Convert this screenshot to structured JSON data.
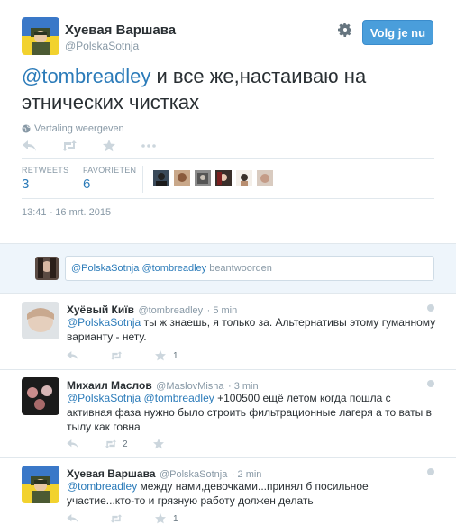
{
  "header": {
    "name": "Хуевая Варшава",
    "handle": "@PolskaSotnja",
    "follow_label": "Volg je nu"
  },
  "tweet": {
    "mention": "@tombreadley",
    "text": " и все же,настаиваю на этнических чистках",
    "translate_label": "Vertaling weergeven",
    "retweets_label": "RETWEETS",
    "retweets_count": "3",
    "favorites_label": "FAVORIETEN",
    "favorites_count": "6",
    "timestamp": "13:41 - 16 mrt. 2015"
  },
  "reply_box": {
    "mention_1": "@PolskaSotnja",
    "mention_2": "@tombreadley",
    "suffix": " beantwoorden"
  },
  "replies": [
    {
      "name": "Хуёвый Київ",
      "handle": "@tombreadley",
      "time": "· 5 min",
      "mention": "@PolskaSotnja",
      "text": " ты ж знаешь, я только за. Альтернативы этому гуманному варианту - нету.",
      "retweets": "",
      "favorites": "1"
    },
    {
      "name": "Михаил Маслов",
      "handle": "@MaslovMisha",
      "time": "· 3 min",
      "mention": "@PolskaSotnja @tombreadley",
      "text": " +100500 ещё летом когда пошла с активная фаза нужно было строить фильтрационные лагеря а то ваты в тылу как говна",
      "retweets": "2",
      "favorites": ""
    },
    {
      "name": "Хуевая Варшава",
      "handle": "@PolskaSotnja",
      "time": "· 2 min",
      "mention": "@tombreadley",
      "text": " между нами,девочками...принял б посильное участие...кто-то и грязную работу должен делать",
      "retweets": "",
      "favorites": "1"
    }
  ],
  "colors": {
    "link": "#2b7bb9",
    "follow_button": "#4a9edb",
    "reply_bar_bg": "#eef5fb"
  },
  "icons": [
    "gear-icon",
    "reply-icon",
    "retweet-icon",
    "favorite-icon",
    "more-icon",
    "globe-icon"
  ]
}
